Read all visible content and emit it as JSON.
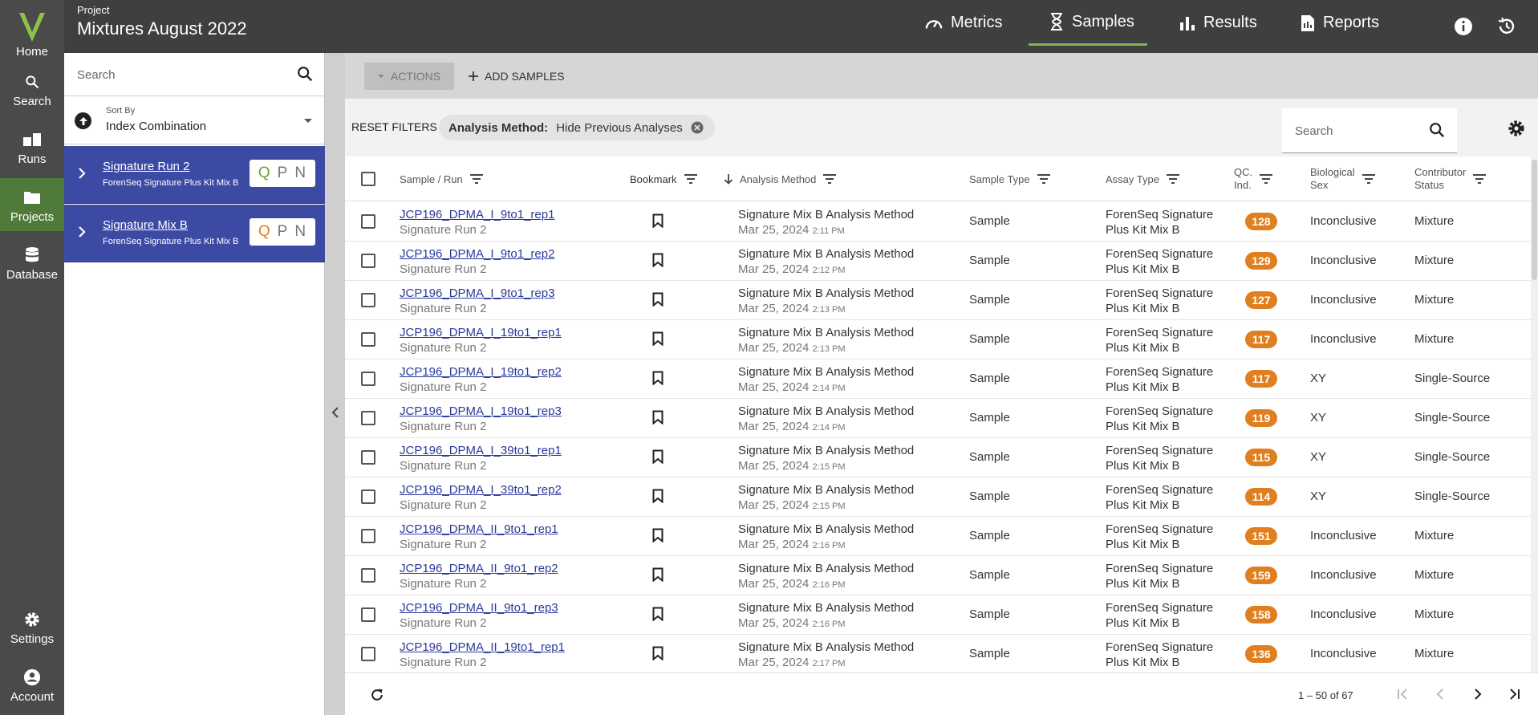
{
  "rail": {
    "items": [
      {
        "label": "Home"
      },
      {
        "label": "Search"
      },
      {
        "label": "Runs"
      },
      {
        "label": "Projects"
      },
      {
        "label": "Database"
      },
      {
        "label": "Settings"
      },
      {
        "label": "Account"
      }
    ]
  },
  "header": {
    "project_label": "Project",
    "project_title": "Mixtures August 2022",
    "tabs": [
      {
        "label": "Metrics"
      },
      {
        "label": "Samples"
      },
      {
        "label": "Results"
      },
      {
        "label": "Reports"
      }
    ]
  },
  "sidepanel": {
    "search_placeholder": "Search",
    "sort_label": "Sort By",
    "sort_value": "Index Combination",
    "runs": [
      {
        "name": "Signature Run 2",
        "kit": "ForenSeq Signature Plus Kit Mix B",
        "q": "Q",
        "p": "P",
        "n": "N"
      },
      {
        "name": "Signature Mix B",
        "kit": "ForenSeq Signature Plus Kit Mix B",
        "q": "Q",
        "p": "P",
        "n": "N"
      }
    ]
  },
  "toolbar": {
    "actions_label": "ACTIONS",
    "add_samples_label": "ADD SAMPLES",
    "reset_filters_label": "RESET FILTERS",
    "filter_chip_key": "Analysis Method:",
    "filter_chip_value": "Hide Previous Analyses",
    "table_search_placeholder": "Search"
  },
  "table": {
    "headers": {
      "sample_run": "Sample / Run",
      "bookmark": "Bookmark",
      "analysis_method": "Analysis Method",
      "sample_type": "Sample Type",
      "assay_type": "Assay Type",
      "qc_ind_1": "QC.",
      "qc_ind_2": "Ind.",
      "bio_sex_1": "Biological",
      "bio_sex_2": "Sex",
      "contrib_1": "Contributor",
      "contrib_2": "Status"
    },
    "rows": [
      {
        "sample": "JCP196_DPMA_I_9to1_rep1",
        "run": "Signature Run 2",
        "method": "Signature Mix B Analysis Method",
        "date": "Mar 25, 2024",
        "time": "2:11 PM",
        "type": "Sample",
        "assay1": "ForenSeq Signature",
        "assay2": "Plus Kit Mix B",
        "qc": "128",
        "sex": "Inconclusive",
        "status": "Mixture"
      },
      {
        "sample": "JCP196_DPMA_I_9to1_rep2",
        "run": "Signature Run 2",
        "method": "Signature Mix B Analysis Method",
        "date": "Mar 25, 2024",
        "time": "2:12 PM",
        "type": "Sample",
        "assay1": "ForenSeq Signature",
        "assay2": "Plus Kit Mix B",
        "qc": "129",
        "sex": "Inconclusive",
        "status": "Mixture"
      },
      {
        "sample": "JCP196_DPMA_I_9to1_rep3",
        "run": "Signature Run 2",
        "method": "Signature Mix B Analysis Method",
        "date": "Mar 25, 2024",
        "time": "2:13 PM",
        "type": "Sample",
        "assay1": "ForenSeq Signature",
        "assay2": "Plus Kit Mix B",
        "qc": "127",
        "sex": "Inconclusive",
        "status": "Mixture"
      },
      {
        "sample": "JCP196_DPMA_I_19to1_rep1",
        "run": "Signature Run 2",
        "method": "Signature Mix B Analysis Method",
        "date": "Mar 25, 2024",
        "time": "2:13 PM",
        "type": "Sample",
        "assay1": "ForenSeq Signature",
        "assay2": "Plus Kit Mix B",
        "qc": "117",
        "sex": "Inconclusive",
        "status": "Mixture"
      },
      {
        "sample": "JCP196_DPMA_I_19to1_rep2",
        "run": "Signature Run 2",
        "method": "Signature Mix B Analysis Method",
        "date": "Mar 25, 2024",
        "time": "2:14 PM",
        "type": "Sample",
        "assay1": "ForenSeq Signature",
        "assay2": "Plus Kit Mix B",
        "qc": "117",
        "sex": "XY",
        "status": "Single-Source"
      },
      {
        "sample": "JCP196_DPMA_I_19to1_rep3",
        "run": "Signature Run 2",
        "method": "Signature Mix B Analysis Method",
        "date": "Mar 25, 2024",
        "time": "2:14 PM",
        "type": "Sample",
        "assay1": "ForenSeq Signature",
        "assay2": "Plus Kit Mix B",
        "qc": "119",
        "sex": "XY",
        "status": "Single-Source"
      },
      {
        "sample": "JCP196_DPMA_I_39to1_rep1",
        "run": "Signature Run 2",
        "method": "Signature Mix B Analysis Method",
        "date": "Mar 25, 2024",
        "time": "2:15 PM",
        "type": "Sample",
        "assay1": "ForenSeq Signature",
        "assay2": "Plus Kit Mix B",
        "qc": "115",
        "sex": "XY",
        "status": "Single-Source"
      },
      {
        "sample": "JCP196_DPMA_I_39to1_rep2",
        "run": "Signature Run 2",
        "method": "Signature Mix B Analysis Method",
        "date": "Mar 25, 2024",
        "time": "2:15 PM",
        "type": "Sample",
        "assay1": "ForenSeq Signature",
        "assay2": "Plus Kit Mix B",
        "qc": "114",
        "sex": "XY",
        "status": "Single-Source"
      },
      {
        "sample": "JCP196_DPMA_II_9to1_rep1",
        "run": "Signature Run 2",
        "method": "Signature Mix B Analysis Method",
        "date": "Mar 25, 2024",
        "time": "2:16 PM",
        "type": "Sample",
        "assay1": "ForenSeq Signature",
        "assay2": "Plus Kit Mix B",
        "qc": "151",
        "sex": "Inconclusive",
        "status": "Mixture"
      },
      {
        "sample": "JCP196_DPMA_II_9to1_rep2",
        "run": "Signature Run 2",
        "method": "Signature Mix B Analysis Method",
        "date": "Mar 25, 2024",
        "time": "2:16 PM",
        "type": "Sample",
        "assay1": "ForenSeq Signature",
        "assay2": "Plus Kit Mix B",
        "qc": "159",
        "sex": "Inconclusive",
        "status": "Mixture"
      },
      {
        "sample": "JCP196_DPMA_II_9to1_rep3",
        "run": "Signature Run 2",
        "method": "Signature Mix B Analysis Method",
        "date": "Mar 25, 2024",
        "time": "2:16 PM",
        "type": "Sample",
        "assay1": "ForenSeq Signature",
        "assay2": "Plus Kit Mix B",
        "qc": "158",
        "sex": "Inconclusive",
        "status": "Mixture"
      },
      {
        "sample": "JCP196_DPMA_II_19to1_rep1",
        "run": "Signature Run 2",
        "method": "Signature Mix B Analysis Method",
        "date": "Mar 25, 2024",
        "time": "2:17 PM",
        "type": "Sample",
        "assay1": "ForenSeq Signature",
        "assay2": "Plus Kit Mix B",
        "qc": "136",
        "sex": "Inconclusive",
        "status": "Mixture"
      }
    ]
  },
  "footer": {
    "range_label": "1 – 50 of 67"
  },
  "colors": {
    "accent_green": "#7fb356",
    "run_card_blue": "#3d4aa3",
    "qc_badge_orange": "#e07f1f",
    "link_blue": "#2b3a9b"
  }
}
